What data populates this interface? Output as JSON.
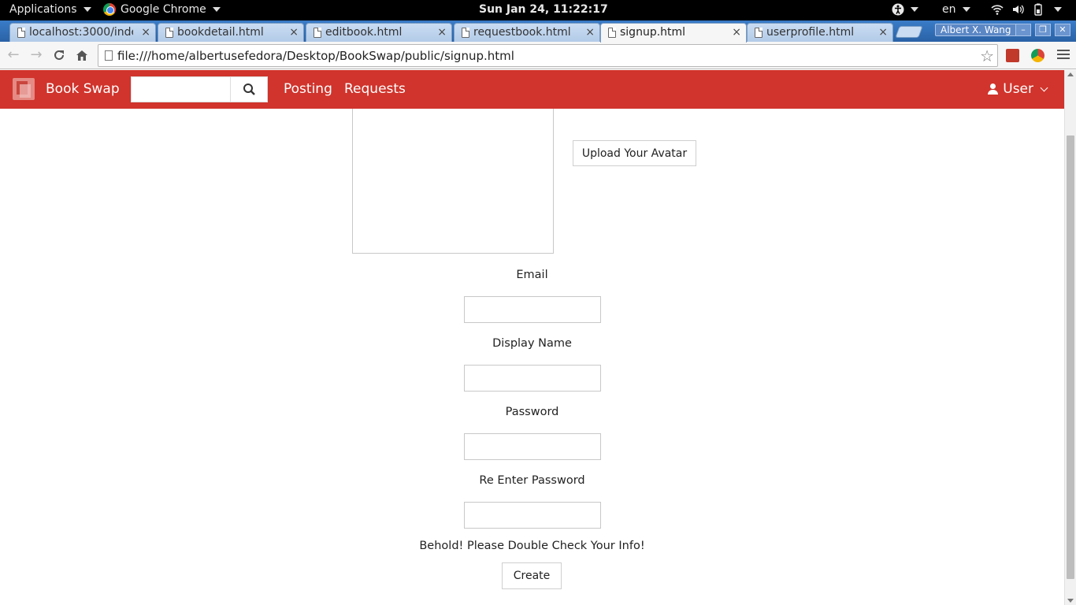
{
  "system": {
    "applications_label": "Applications",
    "app_label": "Google Chrome",
    "clock": "Sun Jan 24, 11:22:17",
    "language": "en"
  },
  "browser": {
    "tabs": [
      {
        "title": "localhost:3000/inde",
        "active": false
      },
      {
        "title": "bookdetail.html",
        "active": false
      },
      {
        "title": "editbook.html",
        "active": false
      },
      {
        "title": "requestbook.html",
        "active": false
      },
      {
        "title": "signup.html",
        "active": true
      },
      {
        "title": "userprofile.html",
        "active": false
      }
    ],
    "close_glyph": "×",
    "profile_name": "Albert X. Wang",
    "url": "file:///home/albertusefedora/Desktop/BookSwap/public/signup.html"
  },
  "app": {
    "brand": "Book Swap",
    "accent_color": "#d0342c",
    "nav": {
      "posting": "Posting",
      "requests": "Requests",
      "user": "User"
    },
    "search_placeholder": ""
  },
  "form": {
    "upload_label": "Upload Your Avatar",
    "email_label": "Email",
    "email_value": "",
    "display_name_label": "Display Name",
    "display_name_value": "",
    "password_label": "Password",
    "password_value": "",
    "reenter_label": "Re Enter Password",
    "reenter_value": "",
    "notice": "Behold! Please Double Check Your Info!",
    "create_label": "Create"
  }
}
